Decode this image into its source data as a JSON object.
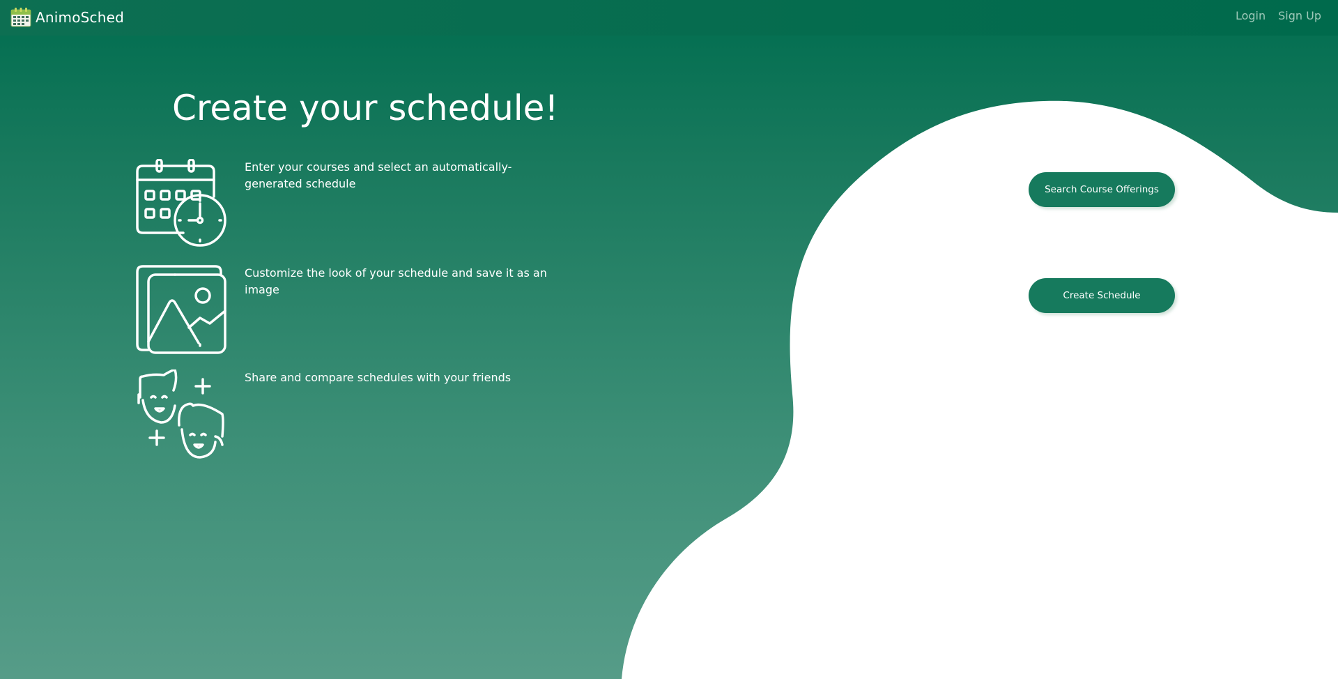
{
  "navbar": {
    "brand_name": "AnimoSched",
    "links": {
      "login": "Login",
      "signup": "Sign Up"
    }
  },
  "hero": {
    "title": "Create your schedule!"
  },
  "features": [
    {
      "icon": "calendar-clock-icon",
      "text": "Enter your courses and select an automatically-generated schedule"
    },
    {
      "icon": "image-gallery-icon",
      "text": "Customize the look of your schedule and save it as an image"
    },
    {
      "icon": "friends-icon",
      "text": "Share and compare schedules with your friends"
    }
  ],
  "actions": {
    "search_label": "Search Course Offerings",
    "create_label": "Create Schedule"
  },
  "colors": {
    "nav_bg": "#006a4c",
    "accent_green": "#167a5d",
    "nav_link": "#9ec9b9",
    "blob": "#ffffff"
  }
}
